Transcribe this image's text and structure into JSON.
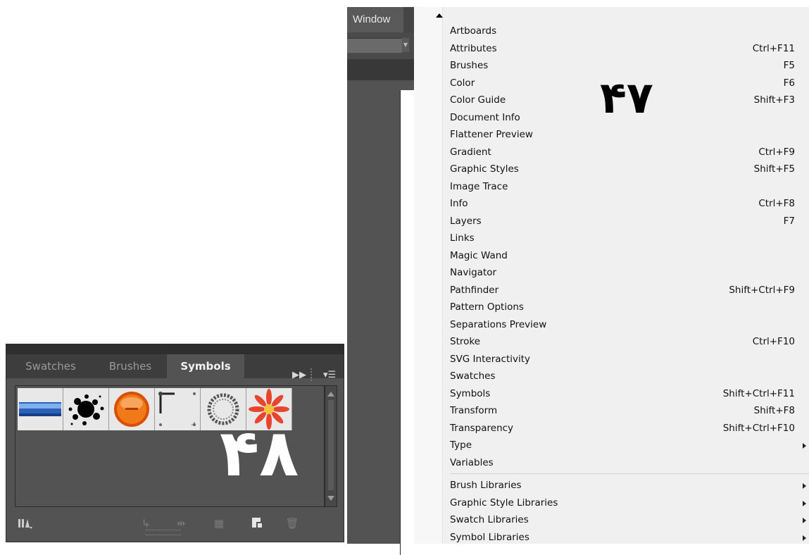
{
  "app": {
    "menubar": {
      "window_label": "Window"
    }
  },
  "menu": {
    "items": [
      {
        "label": "Artboards",
        "shortcut": ""
      },
      {
        "label": "Attributes",
        "shortcut": "Ctrl+F11"
      },
      {
        "label": "Brushes",
        "shortcut": "F5"
      },
      {
        "label": "Color",
        "shortcut": "F6"
      },
      {
        "label": "Color Guide",
        "shortcut": "Shift+F3"
      },
      {
        "label": "Document Info",
        "shortcut": ""
      },
      {
        "label": "Flattener Preview",
        "shortcut": ""
      },
      {
        "label": "Gradient",
        "shortcut": "Ctrl+F9"
      },
      {
        "label": "Graphic Styles",
        "shortcut": "Shift+F5"
      },
      {
        "label": "Image Trace",
        "shortcut": ""
      },
      {
        "label": "Info",
        "shortcut": "Ctrl+F8"
      },
      {
        "label": "Layers",
        "shortcut": "F7"
      },
      {
        "label": "Links",
        "shortcut": ""
      },
      {
        "label": "Magic Wand",
        "shortcut": ""
      },
      {
        "label": "Navigator",
        "shortcut": ""
      },
      {
        "label": "Pathfinder",
        "shortcut": "Shift+Ctrl+F9"
      },
      {
        "label": "Pattern Options",
        "shortcut": ""
      },
      {
        "label": "Separations Preview",
        "shortcut": ""
      },
      {
        "label": "Stroke",
        "shortcut": "Ctrl+F10"
      },
      {
        "label": "SVG Interactivity",
        "shortcut": ""
      },
      {
        "label": "Swatches",
        "shortcut": ""
      },
      {
        "label": "Symbols",
        "shortcut": "Shift+Ctrl+F11"
      },
      {
        "label": "Transform",
        "shortcut": "Shift+F8"
      },
      {
        "label": "Transparency",
        "shortcut": "Shift+Ctrl+F10"
      },
      {
        "label": "Type",
        "shortcut": "",
        "submenu": true
      },
      {
        "label": "Variables",
        "shortcut": ""
      }
    ],
    "library_items": [
      {
        "label": "Brush Libraries",
        "submenu": true
      },
      {
        "label": "Graphic Style Libraries",
        "submenu": true
      },
      {
        "label": "Swatch Libraries",
        "submenu": true
      },
      {
        "label": "Symbol Libraries",
        "submenu": true
      }
    ]
  },
  "annotations": {
    "menu_number": "۴۷",
    "panel_number": "۴۸"
  },
  "panel": {
    "tabs": [
      {
        "label": "Swatches",
        "active": false
      },
      {
        "label": "Brushes",
        "active": false
      },
      {
        "label": "Symbols",
        "active": true
      }
    ],
    "symbols": [
      {
        "icon": "blue-banner-symbol-icon"
      },
      {
        "icon": "ink-splat-symbol-icon"
      },
      {
        "icon": "orange-button-symbol-icon"
      },
      {
        "icon": "frame-corners-symbol-icon"
      },
      {
        "icon": "dot-wreath-symbol-icon"
      },
      {
        "icon": "red-flower-symbol-icon"
      }
    ],
    "footer_buttons": [
      {
        "icon": "symbol-libraries-menu-icon"
      },
      {
        "icon": "place-symbol-instance-icon"
      },
      {
        "icon": "break-link-to-symbol-icon"
      },
      {
        "icon": "symbol-options-icon"
      },
      {
        "icon": "new-symbol-icon"
      },
      {
        "icon": "delete-symbol-icon"
      }
    ]
  },
  "colors": {
    "app_background": "#535353",
    "menu_background": "#f0f0f0",
    "panel_background": "#535353",
    "active_tab_text": "#f2f2f2",
    "inactive_tab_text": "#9a9a9a"
  }
}
